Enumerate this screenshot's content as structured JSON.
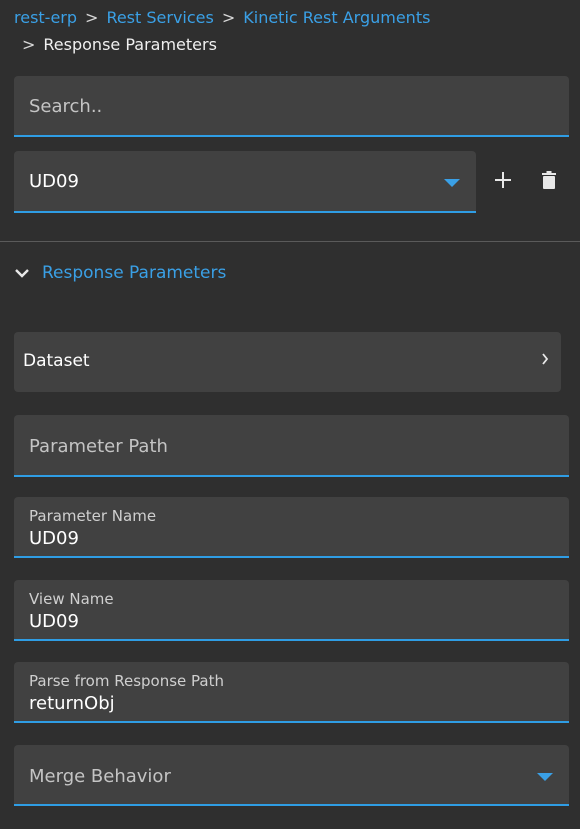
{
  "breadcrumb": {
    "items": [
      "rest-erp",
      "Rest Services",
      "Kinetic Rest Arguments"
    ],
    "separator": ">",
    "current": "Response Parameters"
  },
  "search": {
    "placeholder": "Search.."
  },
  "record_select": {
    "value": "UD09"
  },
  "section": {
    "title": "Response Parameters"
  },
  "dataset": {
    "label": "Dataset"
  },
  "fields": {
    "parameter_path": {
      "placeholder": "Parameter Path"
    },
    "parameter_name": {
      "label": "Parameter Name",
      "value": "UD09"
    },
    "view_name": {
      "label": "View Name",
      "value": "UD09"
    },
    "parse_path": {
      "label": "Parse from Response Path",
      "value": "returnObj"
    },
    "merge_behavior": {
      "placeholder": "Merge Behavior"
    }
  },
  "icons": {
    "add": "plus-icon",
    "delete": "trash-icon",
    "dropdown": "caret-down-icon",
    "expand": "chevron-down-icon",
    "navigate": "chevron-right-icon"
  },
  "colors": {
    "accent": "#3aa0e6",
    "background": "#2f2f2f",
    "field": "#414141"
  }
}
